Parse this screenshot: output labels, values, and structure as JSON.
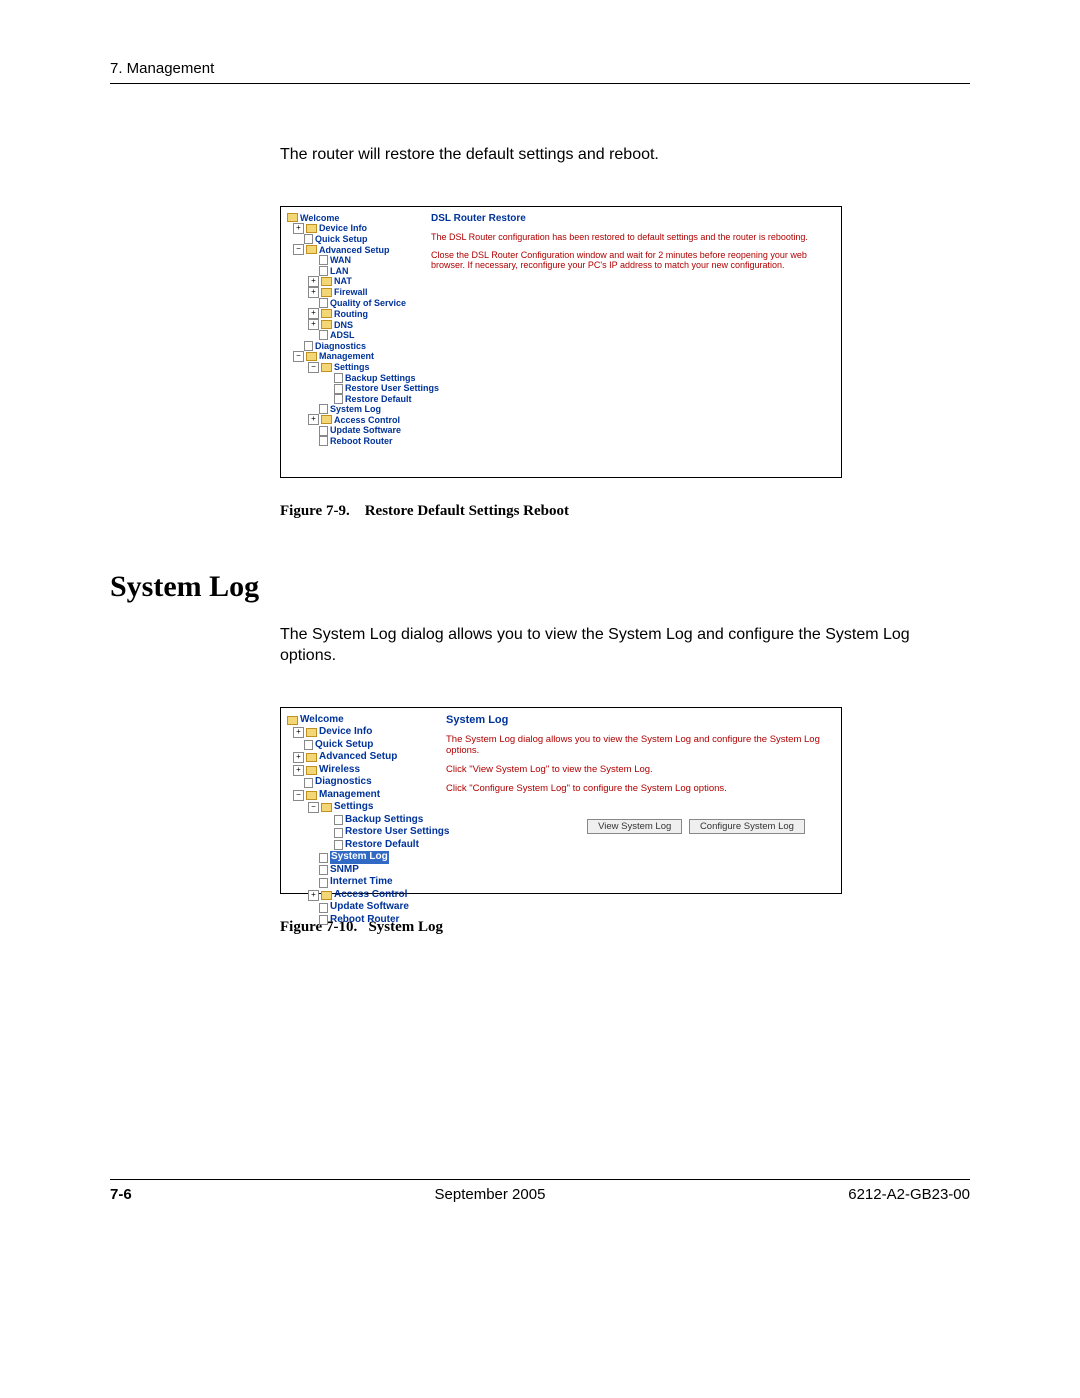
{
  "header": {
    "chapter": "7. Management"
  },
  "intro_text": "The router will restore the default settings and reboot.",
  "figure1": {
    "tree": {
      "welcome": "Welcome",
      "device_info": "Device Info",
      "quick_setup": "Quick Setup",
      "advanced_setup": "Advanced Setup",
      "wan": "WAN",
      "lan": "LAN",
      "nat": "NAT",
      "firewall": "Firewall",
      "qos": "Quality of Service",
      "routing": "Routing",
      "dns": "DNS",
      "adsl": "ADSL",
      "diagnostics": "Diagnostics",
      "management": "Management",
      "settings": "Settings",
      "backup_settings": "Backup Settings",
      "restore_user": "Restore User Settings",
      "restore_default": "Restore Default",
      "system_log": "System Log",
      "access_control": "Access Control",
      "update_software": "Update Software",
      "reboot_router": "Reboot Router"
    },
    "content": {
      "title": "DSL Router Restore",
      "line1": "The DSL Router configuration has been restored to default settings and the router is rebooting.",
      "line2": "Close the DSL Router Configuration window and wait for 2 minutes before reopening your web browser. If necessary, reconfigure your PC's IP address to match your new configuration."
    },
    "caption_label": "Figure 7-9.",
    "caption_title": "Restore Default Settings Reboot"
  },
  "section_heading": "System Log",
  "section_text": "The System Log dialog allows you to view the System Log and configure the System Log options.",
  "figure2": {
    "tree": {
      "welcome": "Welcome",
      "device_info": "Device Info",
      "quick_setup": "Quick Setup",
      "advanced_setup": "Advanced Setup",
      "wireless": "Wireless",
      "diagnostics": "Diagnostics",
      "management": "Management",
      "settings": "Settings",
      "backup_settings": "Backup Settings",
      "restore_user": "Restore User Settings",
      "restore_default": "Restore Default",
      "system_log": "System Log",
      "snmp": "SNMP",
      "internet_time": "Internet Time",
      "access_control": "Access Control",
      "update_software": "Update Software",
      "reboot_router": "Reboot Router"
    },
    "content": {
      "title": "System Log",
      "line1": "The System Log dialog allows you to view the System Log and configure the System Log options.",
      "line2": "Click \"View System Log\" to view the System Log.",
      "line3": "Click \"Configure System Log\" to configure the System Log options.",
      "btn_view": "View System Log",
      "btn_config": "Configure System Log"
    },
    "caption_label": "Figure 7-10.",
    "caption_title": "System Log"
  },
  "footer": {
    "page": "7-6",
    "center": "September 2005",
    "right": "6212-A2-GB23-00"
  }
}
